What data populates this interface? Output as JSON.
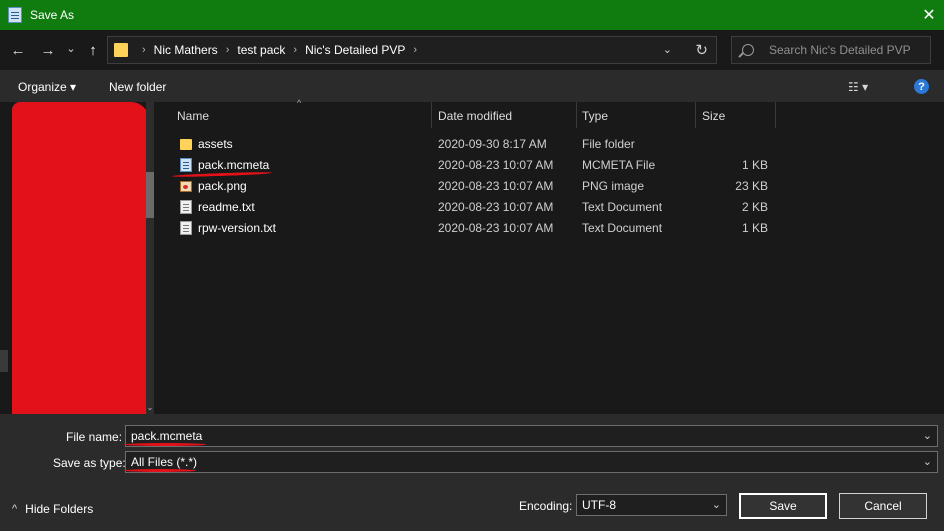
{
  "window": {
    "title": "Save As",
    "app_icon": "notepad-icon",
    "close_glyph": "✕",
    "titlebar_color": "#107c10"
  },
  "nav": {
    "back_glyph": "←",
    "forward_glyph": "→",
    "recent_glyph": "⌄",
    "up_glyph": "↑",
    "breadcrumbs": [
      "Nic Mathers",
      "test pack",
      "Nic's Detailed PVP"
    ],
    "separator": "›",
    "dropdown_glyph": "⌄",
    "refresh_glyph": "↻",
    "search_placeholder": "Search Nic's Detailed PVP"
  },
  "toolbar": {
    "organize_label": "Organize ▾",
    "new_folder_label": "New folder",
    "view_label": "☷ ▾",
    "help_label": "?"
  },
  "columns": {
    "name": "Name",
    "date": "Date modified",
    "type": "Type",
    "size": "Size",
    "sort_glyph": "^"
  },
  "files": [
    {
      "name": "assets",
      "date": "2020-09-30 8:17 AM",
      "type": "File folder",
      "size": "",
      "icon": "folder-icon"
    },
    {
      "name": "pack.mcmeta",
      "date": "2020-08-23 10:07 AM",
      "type": "MCMETA File",
      "size": "1 KB",
      "icon": "mcmeta-file-icon"
    },
    {
      "name": "pack.png",
      "date": "2020-08-23 10:07 AM",
      "type": "PNG image",
      "size": "23 KB",
      "icon": "image-file-icon"
    },
    {
      "name": "readme.txt",
      "date": "2020-08-23 10:07 AM",
      "type": "Text Document",
      "size": "2 KB",
      "icon": "text-file-icon"
    },
    {
      "name": "rpw-version.txt",
      "date": "2020-08-23 10:07 AM",
      "type": "Text Document",
      "size": "1 KB",
      "icon": "text-file-icon"
    }
  ],
  "form": {
    "file_name_label": "File name:",
    "file_name_value": "pack.mcmeta",
    "save_as_type_label": "Save as type:",
    "save_as_type_value": "All Files  (*.*)",
    "encoding_label": "Encoding:",
    "encoding_value": "UTF-8",
    "dropdown_glyph": "⌄"
  },
  "footer": {
    "hide_folders_label": "Hide Folders",
    "hide_glyph": "^",
    "save_label": "Save",
    "cancel_label": "Cancel"
  },
  "annotation_color": "#e3111a"
}
